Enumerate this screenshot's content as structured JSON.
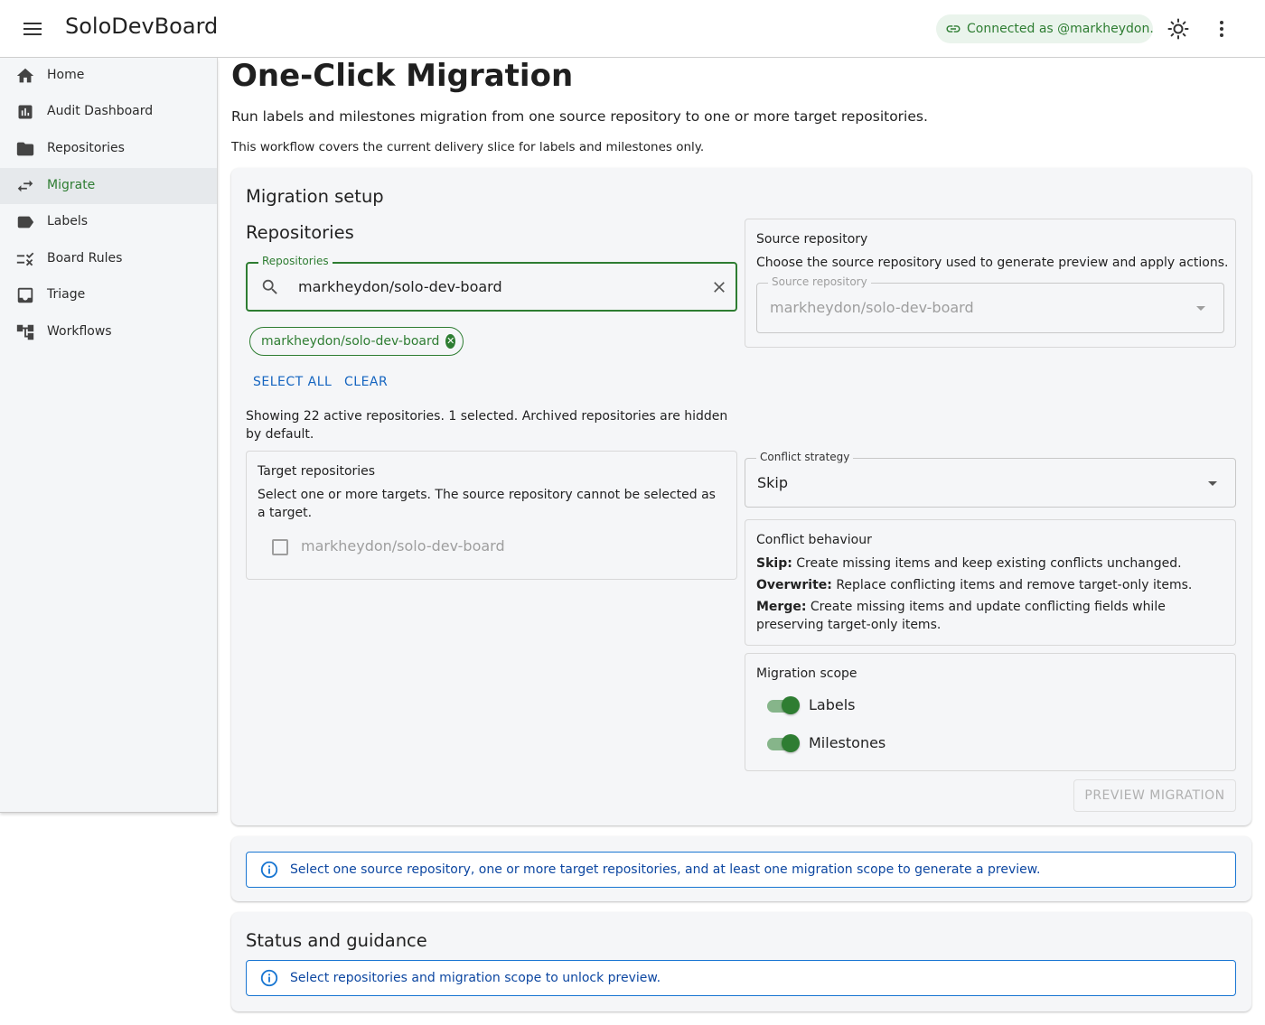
{
  "app": {
    "title": "SoloDevBoard",
    "connection": "Connected as @markheydon.",
    "accent_color": "#2e7d32",
    "info_color": "#1976d2"
  },
  "sidebar": {
    "items": [
      {
        "label": "Home",
        "icon": "home-icon"
      },
      {
        "label": "Audit Dashboard",
        "icon": "chart-icon"
      },
      {
        "label": "Repositories",
        "icon": "folder-icon"
      },
      {
        "label": "Migrate",
        "icon": "swap-icon",
        "active": true
      },
      {
        "label": "Labels",
        "icon": "label-icon"
      },
      {
        "label": "Board Rules",
        "icon": "rule-icon"
      },
      {
        "label": "Triage",
        "icon": "inbox-icon"
      },
      {
        "label": "Workflows",
        "icon": "workflow-icon"
      }
    ]
  },
  "page": {
    "title": "One-Click Migration",
    "subtitle": "Run labels and milestones migration from one source repository to one or more target repositories.",
    "note": "This workflow covers the current delivery slice for labels and milestones only."
  },
  "setup": {
    "heading": "Migration setup",
    "repositories": {
      "heading": "Repositories",
      "field_label": "Repositories",
      "search_value": "markheydon/solo-dev-board",
      "selected_chip": "markheydon/solo-dev-board",
      "select_all": "SELECT ALL",
      "clear": "CLEAR",
      "summary": "Showing 22 active repositories. 1 selected. Archived repositories are hidden by default."
    },
    "target": {
      "title": "Target repositories",
      "description": "Select one or more targets. The source repository cannot be selected as a target.",
      "options": [
        {
          "label": "markheydon/solo-dev-board",
          "checked": false,
          "disabled": true
        }
      ]
    },
    "source": {
      "title": "Source repository",
      "description": "Choose the source repository used to generate preview and apply actions.",
      "field_label": "Source repository",
      "value": "markheydon/solo-dev-board"
    },
    "conflict_strategy": {
      "label": "Conflict strategy",
      "value": "Skip"
    },
    "conflict_behaviour": {
      "title": "Conflict behaviour",
      "skip_term": "Skip:",
      "skip_text": "Create missing items and keep existing conflicts unchanged.",
      "overwrite_term": "Overwrite:",
      "overwrite_text": "Replace conflicting items and remove target-only items.",
      "merge_term": "Merge:",
      "merge_text": "Create missing items and update conflicting fields while preserving target-only items."
    },
    "scope": {
      "title": "Migration scope",
      "labels_label": "Labels",
      "labels_on": true,
      "milestones_label": "Milestones",
      "milestones_on": true
    },
    "preview_button": "PREVIEW MIGRATION"
  },
  "info_alert": "Select one source repository, one or more target repositories, and at least one migration scope to generate a preview.",
  "status": {
    "heading": "Status and guidance",
    "alert": "Select repositories and migration scope to unlock preview."
  }
}
